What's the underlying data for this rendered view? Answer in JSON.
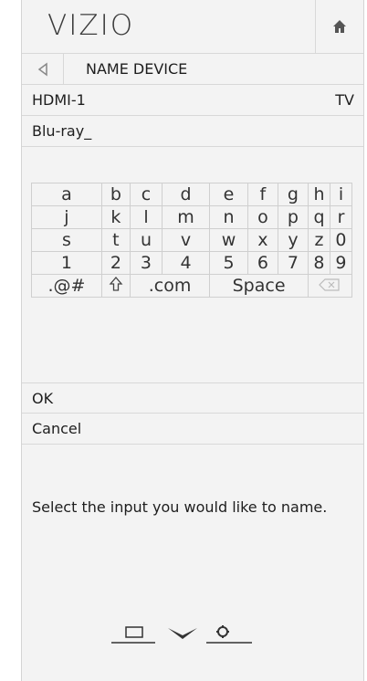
{
  "header": {
    "logo": "VIZIO"
  },
  "nav": {
    "title": "NAME DEVICE"
  },
  "input_row": {
    "label": "HDMI-1",
    "value": "TV"
  },
  "entry": {
    "text": "Blu-ray_"
  },
  "keyboard": {
    "rows": [
      [
        "a",
        "b",
        "c",
        "d",
        "e",
        "f",
        "g",
        "h",
        "i"
      ],
      [
        "j",
        "k",
        "l",
        "m",
        "n",
        "o",
        "p",
        "q",
        "r"
      ],
      [
        "s",
        "t",
        "u",
        "v",
        "w",
        "x",
        "y",
        "z",
        "0"
      ],
      [
        "1",
        "2",
        "3",
        "4",
        "5",
        "6",
        "7",
        "8",
        "9"
      ]
    ],
    "special": {
      "symbols": ".@#",
      "dotcom": ".com",
      "space": "Space"
    }
  },
  "actions": {
    "ok": "OK",
    "cancel": "Cancel"
  },
  "message": "Select the input you would like to name."
}
